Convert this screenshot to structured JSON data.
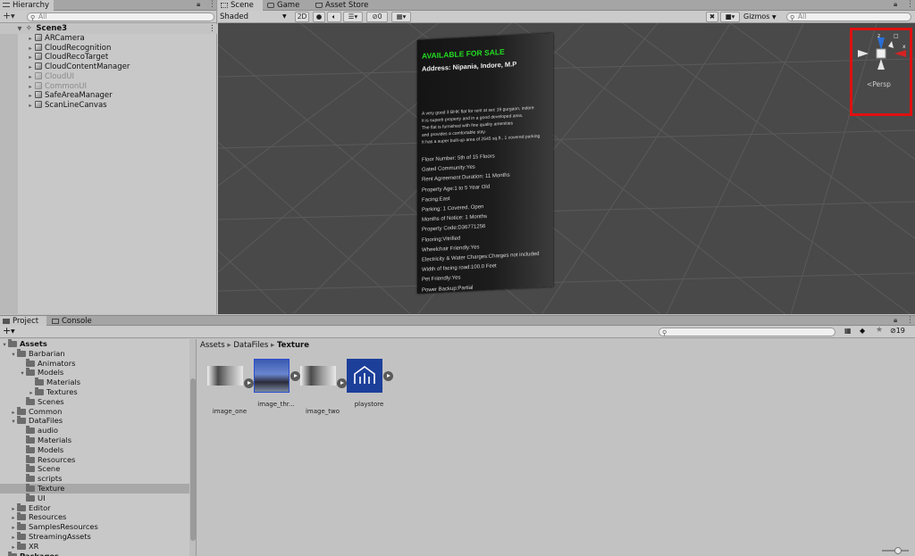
{
  "hierarchy": {
    "tab_label": "Hierarchy",
    "search_placeholder": "All",
    "scene_name": "Scene3",
    "items": [
      {
        "label": "ARCamera",
        "dimmed": false
      },
      {
        "label": "CloudRecognition",
        "dimmed": false
      },
      {
        "label": "CloudRecoTarget",
        "dimmed": false
      },
      {
        "label": "CloudContentManager",
        "dimmed": false
      },
      {
        "label": "CloudUI",
        "dimmed": true
      },
      {
        "label": "CommonUI",
        "dimmed": true
      },
      {
        "label": "SafeAreaManager",
        "dimmed": false
      },
      {
        "label": "ScanLineCanvas",
        "dimmed": false
      }
    ]
  },
  "scene": {
    "tabs": [
      "Scene",
      "Game",
      "Asset Store"
    ],
    "shading_mode": "Shaded",
    "mode_2d": "2D",
    "effects_count": "0",
    "gizmos_label": "Gizmos",
    "search_placeholder": "All",
    "persp_label": "Persp",
    "gizmo_axes": {
      "y": "y",
      "z": "z",
      "x": "x"
    }
  },
  "poster": {
    "title": "AVAILABLE FOR SALE",
    "address": "Address: Nipania, Indore, M.P",
    "description": [
      "A very good 3 BHK flat for rent at sec 19 gurgaon, indore",
      "It is superb property and in a good developed area.",
      "The flat is furnished with fine quality amenities",
      "and provides a comfortable stay.",
      "It has a super built-up area of 2645 sq.ft., 1 covered parking"
    ],
    "details": [
      "Floor Number: 5th of 15 Floors",
      "Gated Community:Yes",
      "Rent Agreement Duration: 11 Months",
      "Property Age:1 to 5 Year Old",
      "Facing:East",
      "Parking: 1 Covered, Open",
      "Months of Notice: 1 Months",
      "Property Code:D36771256",
      "Flooring:Vitrified",
      "Wheelchair Friendly:Yes",
      "Electricity & Water Charges:Charges not included",
      "Width of facing road:100.0 Feet",
      "Pet Friendly:Yes",
      "Power Backup:Partial"
    ],
    "title_color": "#22dd22"
  },
  "project": {
    "tabs": [
      "Project",
      "Console"
    ],
    "breadcrumb": [
      "Assets",
      "DataFiles",
      "Texture"
    ],
    "hidden_count": "19",
    "tree": [
      {
        "label": "Assets",
        "depth": 0,
        "expand": "open",
        "bold": true
      },
      {
        "label": "Barbarian",
        "depth": 1,
        "expand": "open"
      },
      {
        "label": "Animators",
        "depth": 2,
        "expand": "none"
      },
      {
        "label": "Models",
        "depth": 2,
        "expand": "open"
      },
      {
        "label": "Materials",
        "depth": 3,
        "expand": "none"
      },
      {
        "label": "Textures",
        "depth": 3,
        "expand": "closed"
      },
      {
        "label": "Scenes",
        "depth": 2,
        "expand": "none"
      },
      {
        "label": "Common",
        "depth": 1,
        "expand": "closed"
      },
      {
        "label": "DataFiles",
        "depth": 1,
        "expand": "open"
      },
      {
        "label": "audio",
        "depth": 2,
        "expand": "none"
      },
      {
        "label": "Materials",
        "depth": 2,
        "expand": "none"
      },
      {
        "label": "Models",
        "depth": 2,
        "expand": "none"
      },
      {
        "label": "Resources",
        "depth": 2,
        "expand": "none"
      },
      {
        "label": "Scene",
        "depth": 2,
        "expand": "none"
      },
      {
        "label": "scripts",
        "depth": 2,
        "expand": "none"
      },
      {
        "label": "Texture",
        "depth": 2,
        "expand": "none",
        "selected": true
      },
      {
        "label": "UI",
        "depth": 2,
        "expand": "none"
      },
      {
        "label": "Editor",
        "depth": 1,
        "expand": "closed"
      },
      {
        "label": "Resources",
        "depth": 1,
        "expand": "closed"
      },
      {
        "label": "SamplesResources",
        "depth": 1,
        "expand": "closed"
      },
      {
        "label": "StreamingAssets",
        "depth": 1,
        "expand": "closed"
      },
      {
        "label": "XR",
        "depth": 1,
        "expand": "closed"
      },
      {
        "label": "Packages",
        "depth": 0,
        "expand": "closed",
        "bold": true
      }
    ],
    "assets": [
      {
        "label": "image_one",
        "kind": "photo-gray"
      },
      {
        "label": "image_thr...",
        "kind": "photo-blue"
      },
      {
        "label": "image_two",
        "kind": "photo-gray"
      },
      {
        "label": "playstore",
        "kind": "logo"
      }
    ]
  }
}
